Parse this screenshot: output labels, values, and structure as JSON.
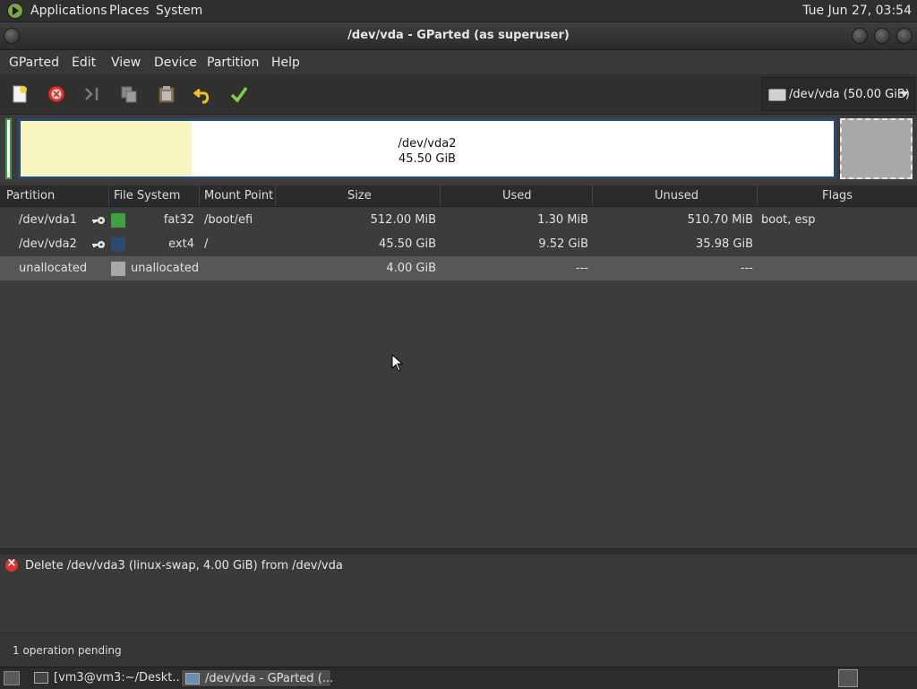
{
  "top_panel": {
    "menus": [
      "Applications",
      "Places",
      "System"
    ],
    "clock": "Tue Jun 27, 03:54"
  },
  "window": {
    "title": "/dev/vda - GParted (as superuser)"
  },
  "menubar": [
    "GParted",
    "Edit",
    "View",
    "Device",
    "Partition",
    "Help"
  ],
  "toolbar": {
    "icons": [
      "new-icon",
      "delete-icon",
      "resize-move-icon",
      "copy-icon",
      "paste-icon",
      "undo-icon",
      "apply-icon"
    ]
  },
  "device_selector": {
    "label": "/dev/vda (50.00 GiB)",
    "icon": "harddisk-icon"
  },
  "graph": {
    "vda2_name": "/dev/vda2",
    "vda2_size": "45.50 GiB",
    "vda2_used_fraction": 0.21,
    "colors": {
      "fat32": "#3fa03f",
      "ext4": "#2b4a73",
      "unallocated": "#a9a9a9",
      "used": "#f7f5be"
    }
  },
  "table": {
    "headers": [
      "Partition",
      "File System",
      "Mount Point",
      "Size",
      "Used",
      "Unused",
      "Flags"
    ],
    "rows": [
      {
        "partition": "/dev/vda1",
        "fs": "fat32",
        "fs_color": "#3fa03f",
        "mount": "/boot/efi",
        "size": "512.00 MiB",
        "used": "1.30 MiB",
        "unused": "510.70 MiB",
        "flags": "boot, esp",
        "mounted": true
      },
      {
        "partition": "/dev/vda2",
        "fs": "ext4",
        "fs_color": "#2b4a73",
        "mount": "/",
        "size": "45.50 GiB",
        "used": "9.52 GiB",
        "unused": "35.98 GiB",
        "flags": "",
        "mounted": true
      },
      {
        "partition": "unallocated",
        "fs": "unallocated",
        "fs_color": "#a9a9a9",
        "mount": "",
        "size": "4.00 GiB",
        "used": "---",
        "unused": "---",
        "flags": "",
        "mounted": false
      }
    ]
  },
  "pending_ops": [
    {
      "icon": "delete-icon",
      "text": "Delete /dev/vda3 (linux-swap, 4.00 GiB) from /dev/vda"
    }
  ],
  "status": "1 operation pending",
  "taskbar": {
    "tasks": [
      {
        "label": "[vm3@vm3:~/Deskt...",
        "icon": "terminal-icon"
      },
      {
        "label": "/dev/vda - GParted (...",
        "icon": "gparted-icon"
      }
    ]
  }
}
